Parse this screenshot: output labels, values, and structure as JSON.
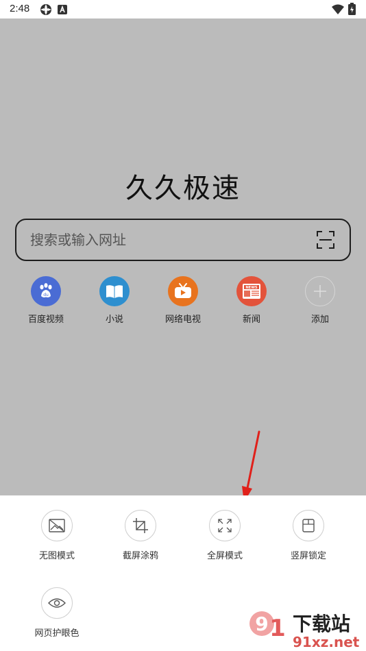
{
  "status_bar": {
    "time": "2:48"
  },
  "app": {
    "title": "久久极速"
  },
  "search": {
    "placeholder": "搜索或输入网址"
  },
  "shortcuts": [
    {
      "label": "百度视频",
      "icon": "baidu-paw-icon",
      "color": "#4a6cd4"
    },
    {
      "label": "小说",
      "icon": "book-icon",
      "color": "#2e8fcf"
    },
    {
      "label": "网络电视",
      "icon": "tv-icon",
      "color": "#e8731e"
    },
    {
      "label": "新闻",
      "icon": "news-icon",
      "color": "#e3533b"
    },
    {
      "label": "添加",
      "icon": "plus-icon",
      "color": "#bbbbbb"
    }
  ],
  "tools": [
    {
      "label": "无图模式",
      "icon": "no-image-icon"
    },
    {
      "label": "截屏涂鸦",
      "icon": "crop-icon"
    },
    {
      "label": "全屏模式",
      "icon": "fullscreen-icon"
    },
    {
      "label": "竖屏锁定",
      "icon": "screen-lock-icon"
    },
    {
      "label": "网页护眼色",
      "icon": "eye-icon"
    }
  ],
  "annotation": {
    "color": "#e0201a"
  },
  "watermark": {
    "brand": "下载站",
    "domain": "91xz.net"
  }
}
